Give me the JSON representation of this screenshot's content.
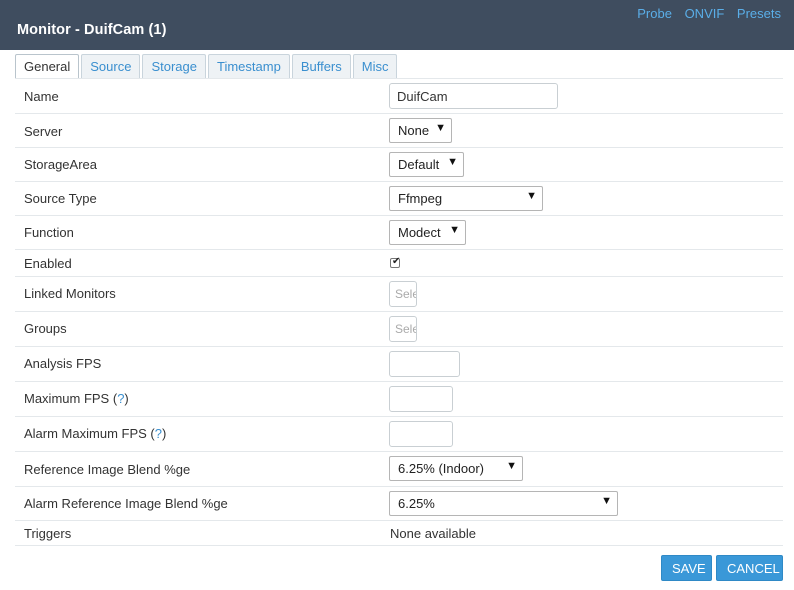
{
  "header": {
    "title": "Monitor - DuifCam (1)",
    "links": [
      "Probe",
      "ONVIF",
      "Presets"
    ]
  },
  "tabs": [
    "General",
    "Source",
    "Storage",
    "Timestamp",
    "Buffers",
    "Misc"
  ],
  "active_tab": "General",
  "form": {
    "name": {
      "label": "Name",
      "value": "DuifCam"
    },
    "server": {
      "label": "Server",
      "value": "None"
    },
    "storage_area": {
      "label": "StorageArea",
      "value": "Default"
    },
    "source_type": {
      "label": "Source Type",
      "value": "Ffmpeg"
    },
    "function": {
      "label": "Function",
      "value": "Modect"
    },
    "enabled": {
      "label": "Enabled",
      "checked": true
    },
    "linked_monitors": {
      "label": "Linked Monitors",
      "placeholder": "Select"
    },
    "groups": {
      "label": "Groups",
      "placeholder": "Select"
    },
    "analysis_fps": {
      "label": "Analysis FPS",
      "value": ""
    },
    "maximum_fps": {
      "label": "Maximum FPS",
      "help": "?",
      "value": ""
    },
    "alarm_maximum_fps": {
      "label": "Alarm Maximum FPS",
      "help": "?",
      "value": ""
    },
    "ref_blend": {
      "label": "Reference Image Blend %ge",
      "value": "6.25% (Indoor)"
    },
    "alarm_ref_blend": {
      "label": "Alarm Reference Image Blend %ge",
      "value": "6.25%"
    },
    "triggers": {
      "label": "Triggers",
      "value": "None available"
    }
  },
  "buttons": {
    "save": "SAVE",
    "cancel": "CANCEL"
  },
  "colors": {
    "header_bg": "#3f4d5f",
    "link": "#5aaee8",
    "button": "#3a98d8"
  }
}
